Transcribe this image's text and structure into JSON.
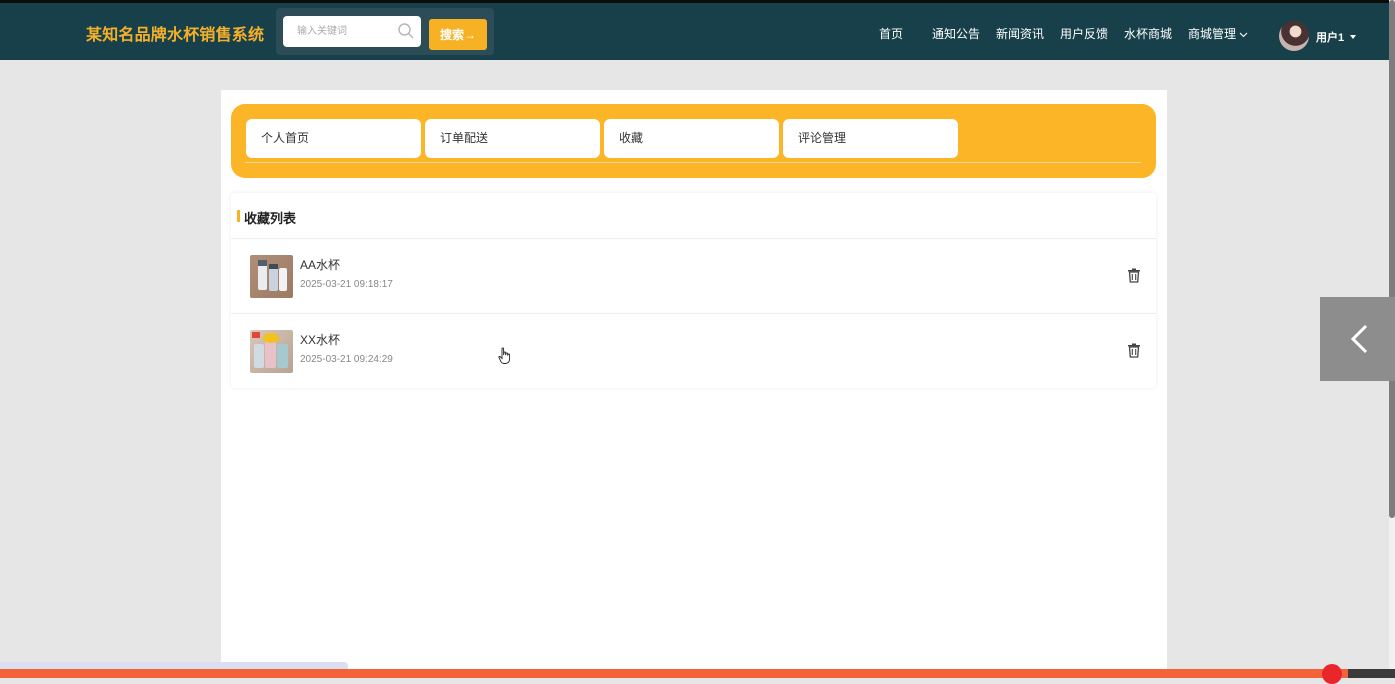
{
  "header": {
    "brand": "某知名品牌水杯销售系统",
    "search_placeholder": "输入关键词",
    "search_button": "搜索→",
    "nav": [
      {
        "label": "首页"
      },
      {
        "label": "通知公告"
      },
      {
        "label": "新闻资讯"
      },
      {
        "label": "用户反馈"
      },
      {
        "label": "水杯商城"
      },
      {
        "label": "商城管理"
      }
    ],
    "user": "用户1"
  },
  "tabs": [
    {
      "label": "个人首页"
    },
    {
      "label": "订单配送"
    },
    {
      "label": "收藏"
    },
    {
      "label": "评论管理"
    }
  ],
  "favorites": {
    "title": "收藏列表",
    "items": [
      {
        "name": "AA水杯",
        "time": "2025-03-21 09:18:17"
      },
      {
        "name": "XX水杯",
        "time": "2025-03-21 09:24:29"
      }
    ]
  },
  "colors": {
    "header_bg": "#17404b",
    "accent": "#f7b125",
    "brand_text": "#f5b02a"
  }
}
